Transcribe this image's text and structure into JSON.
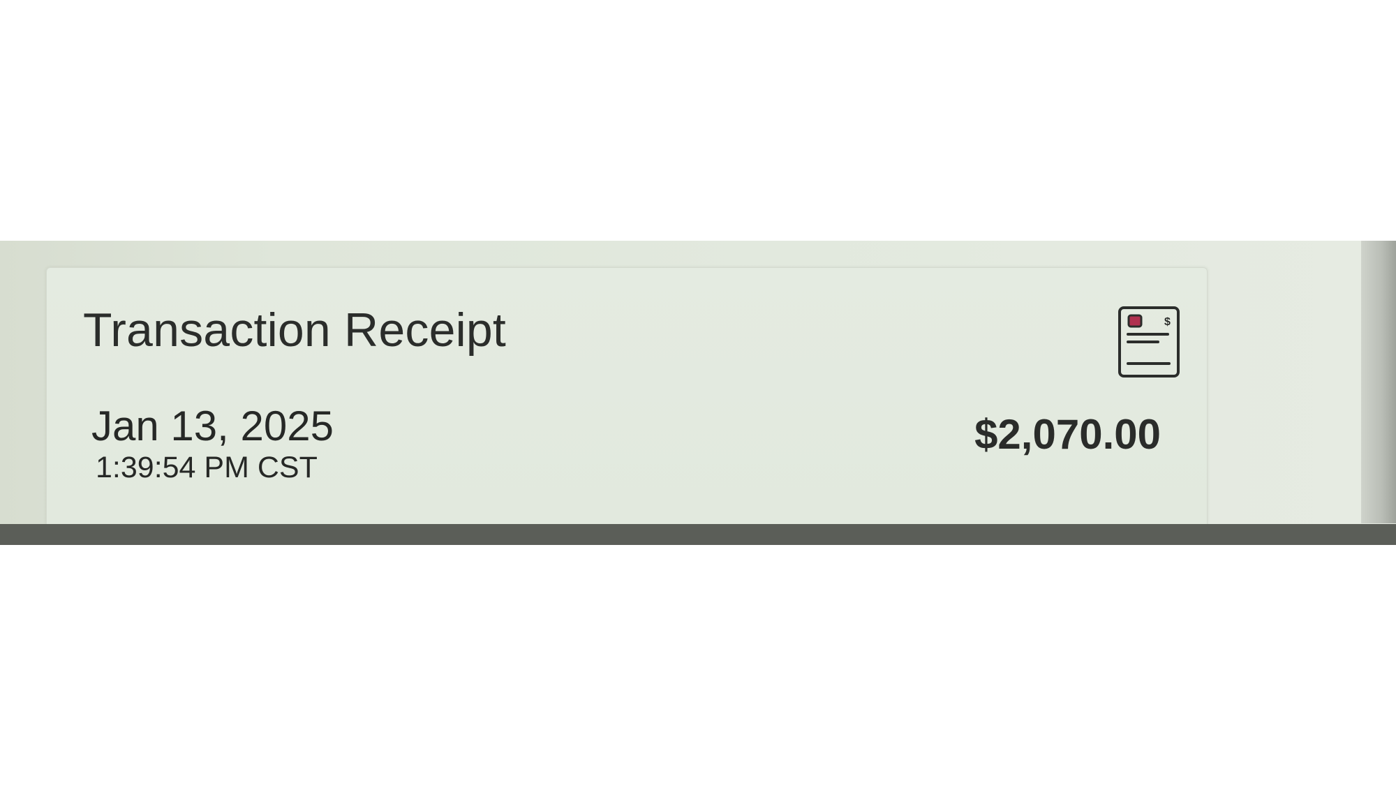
{
  "receipt": {
    "title": "Transaction Receipt",
    "date": "Jan 13, 2025",
    "time": "1:39:54 PM CST",
    "amount": "$2,070.00",
    "icon": "receipt-icon",
    "icon_symbol": "$"
  },
  "colors": {
    "card_background": "#e2e9de",
    "text": "#2b2d2b",
    "icon_accent": "#b0304f"
  }
}
